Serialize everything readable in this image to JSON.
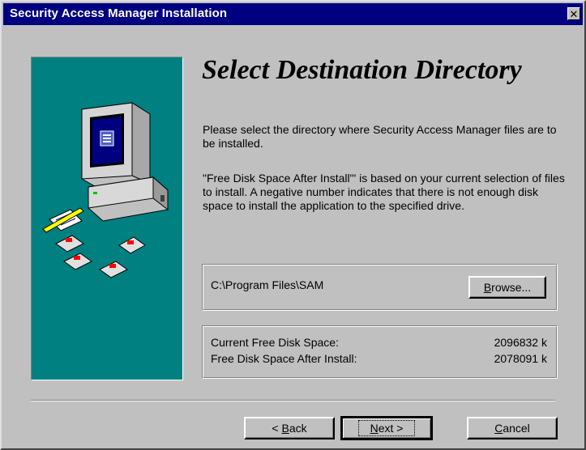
{
  "window": {
    "title": "Security Access Manager Installation",
    "close_glyph": "✕"
  },
  "heading": "Select Destination Directory",
  "paragraphs": [
    "Please select the directory where Security Access Manager files are to be installed.",
    "\"Free Disk Space After Install\"' is based on your current selection of files to install.  A negative number indicates that there is not enough disk space to install the application to the specified drive."
  ],
  "destination": {
    "path": "C:\\Program Files\\SAM",
    "browse_label": "Browse..."
  },
  "disk_space": [
    {
      "label": "Current Free Disk Space:",
      "value": "2096832 k"
    },
    {
      "label": "Free Disk Space After Install:",
      "value": "2078091 k"
    }
  ],
  "buttons": {
    "back": "< Back",
    "next": "Next >",
    "cancel": "Cancel"
  },
  "colors": {
    "titlebar": "#000080",
    "panel": "#008080",
    "face": "#c0c0c0"
  },
  "icons": [
    "computer-icon",
    "notepad-pencil-icon",
    "floppy-disk-icon"
  ]
}
